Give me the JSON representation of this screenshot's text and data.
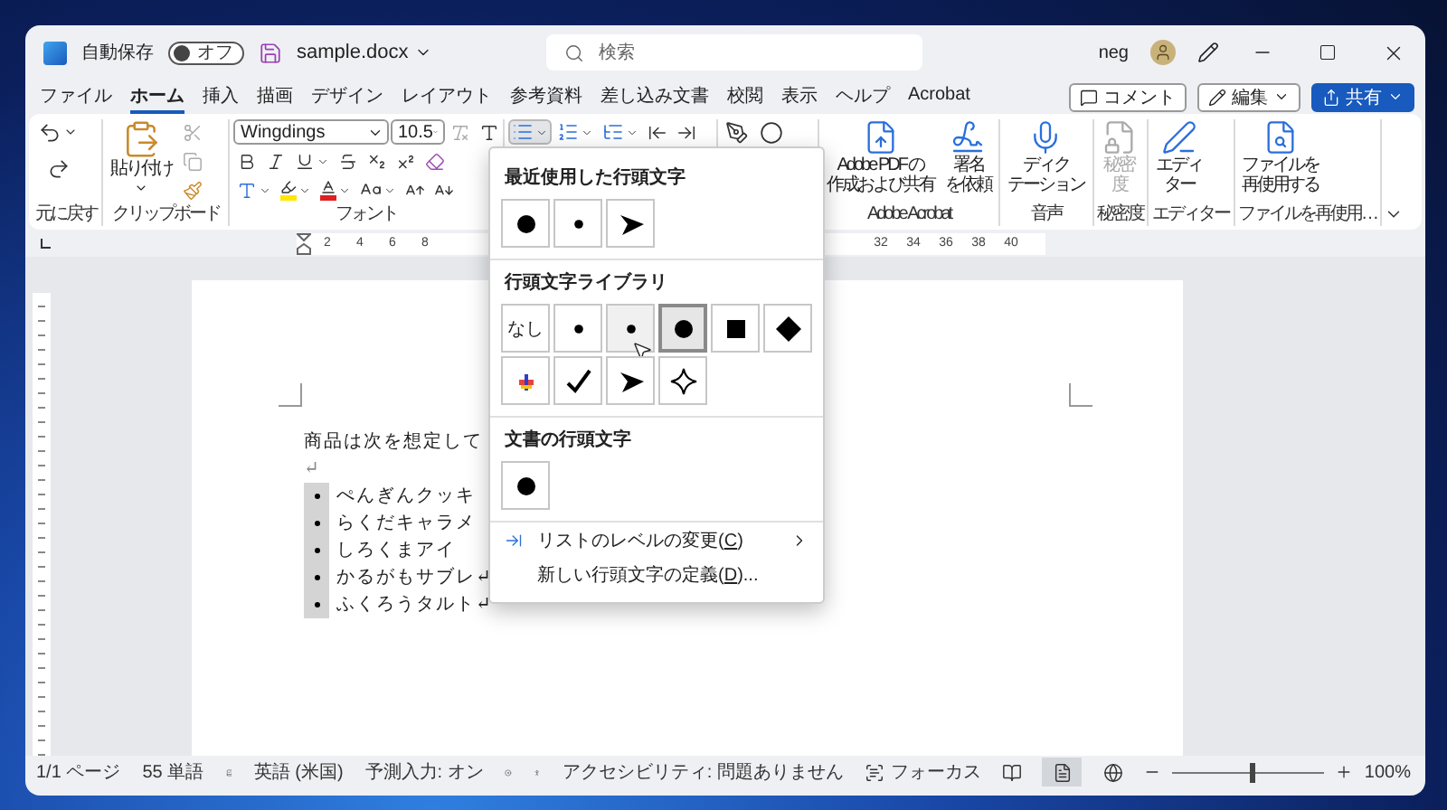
{
  "title_bar": {
    "autosave_label": "自動保存",
    "autosave": {
      "on": false,
      "label": "オフ"
    },
    "file_name": "sample.docx",
    "search": {
      "placeholder": "検索"
    },
    "user": "neg"
  },
  "menu_tabs": [
    {
      "label": "ファイル",
      "selected": false
    },
    {
      "label": "ホーム",
      "selected": true
    },
    {
      "label": "挿入",
      "selected": false
    },
    {
      "label": "描画",
      "selected": false
    },
    {
      "label": "デザイン",
      "selected": false
    },
    {
      "label": "レイアウト",
      "selected": false
    },
    {
      "label": "参考資料",
      "selected": false
    },
    {
      "label": "差し込み文書",
      "selected": false
    },
    {
      "label": "校閲",
      "selected": false
    },
    {
      "label": "表示",
      "selected": false
    },
    {
      "label": "ヘルプ",
      "selected": false
    },
    {
      "label": "Acrobat",
      "selected": false
    }
  ],
  "actions": {
    "comment": "コメント",
    "edit": "編集",
    "share": "共有"
  },
  "ribbon": {
    "undo_group": "元に戻す",
    "paste": "貼り付け",
    "clipboard_group": "クリップボード",
    "font": {
      "name": "Wingdings",
      "size": "10.5",
      "group": "フォント"
    },
    "bullets_button": {
      "open": true
    },
    "groups": [
      {
        "label": "Adobe Acrobat",
        "buttons": [
          {
            "kind": "pdf",
            "lines": [
              "Adobe PDF の",
              "作成および共有"
            ],
            "disabled": false
          },
          {
            "kind": "sign",
            "lines": [
              "署名",
              "を依頼"
            ],
            "disabled": false
          }
        ]
      },
      {
        "label": "音声",
        "buttons": [
          {
            "kind": "mic",
            "lines": [
              "ディク",
              "テーション"
            ],
            "disabled": false
          }
        ]
      },
      {
        "label": "秘密度",
        "buttons": [
          {
            "kind": "sensitivity",
            "lines": [
              "秘密",
              "度"
            ],
            "disabled": true
          }
        ]
      },
      {
        "label": "エディター",
        "buttons": [
          {
            "kind": "editor",
            "lines": [
              "エディ",
              "ター"
            ],
            "disabled": false
          }
        ]
      },
      {
        "label": "ファイルを再使用…",
        "buttons": [
          {
            "kind": "reuse",
            "lines": [
              "ファイルを",
              "再使用する"
            ],
            "disabled": false
          }
        ]
      }
    ]
  },
  "ruler": {
    "left_numbers": [
      "2",
      "4",
      "6",
      "8"
    ],
    "right_numbers": [
      "32",
      "34",
      "36",
      "38",
      "40"
    ]
  },
  "document": {
    "intro": "商品は次を想定して",
    "paragraph_mark": "↵",
    "bullets_selected": true,
    "items": [
      "ぺんぎんクッキ",
      "らくだキャラメ",
      "しろくまアイ",
      "かるがもサブレ↵",
      "ふくろうタルト↵"
    ]
  },
  "bullet_menu": {
    "sections": [
      {
        "title": "最近使用した行頭文字",
        "items": [
          {
            "kind": "large-dot",
            "selected": false,
            "hovered": false
          },
          {
            "kind": "small-dot",
            "selected": false,
            "hovered": false
          },
          {
            "kind": "arrowhead",
            "selected": false,
            "hovered": false
          }
        ]
      },
      {
        "title": "行頭文字ライブラリ",
        "items": [
          {
            "kind": "none",
            "label": "なし",
            "selected": false,
            "hovered": false
          },
          {
            "kind": "small-dot",
            "selected": false,
            "hovered": false
          },
          {
            "kind": "small-dot",
            "selected": false,
            "hovered": true
          },
          {
            "kind": "large-dot",
            "selected": true,
            "hovered": false
          },
          {
            "kind": "square",
            "selected": false,
            "hovered": false
          },
          {
            "kind": "diamond",
            "selected": false,
            "hovered": false
          },
          {
            "kind": "picture",
            "selected": false,
            "hovered": false
          },
          {
            "kind": "check",
            "selected": false,
            "hovered": false
          },
          {
            "kind": "arrowhead",
            "selected": false,
            "hovered": false
          },
          {
            "kind": "star",
            "selected": false,
            "hovered": false
          }
        ]
      },
      {
        "title": "文書の行頭文字",
        "items": [
          {
            "kind": "large-dot",
            "selected": false,
            "hovered": false
          }
        ]
      }
    ],
    "commands": [
      {
        "kind": "submenu",
        "text": "リストのレベルの変更(",
        "access_key": "C",
        "after": ")"
      },
      {
        "kind": "plain",
        "text": "新しい行頭文字の定義(",
        "access_key": "D",
        "after": ")..."
      }
    ]
  },
  "status_bar": {
    "page": "1/1 ページ",
    "words": "55 単語",
    "language": "英語 (米国)",
    "predictive": "予測入力: オン",
    "accessibility": "アクセシビリティ: 問題ありません",
    "focus": "フォーカス",
    "views": [
      {
        "kind": "read",
        "selected": false
      },
      {
        "kind": "print",
        "selected": true
      },
      {
        "kind": "web",
        "selected": false
      }
    ],
    "zoom": {
      "level": 0.52,
      "label": "100%"
    }
  }
}
